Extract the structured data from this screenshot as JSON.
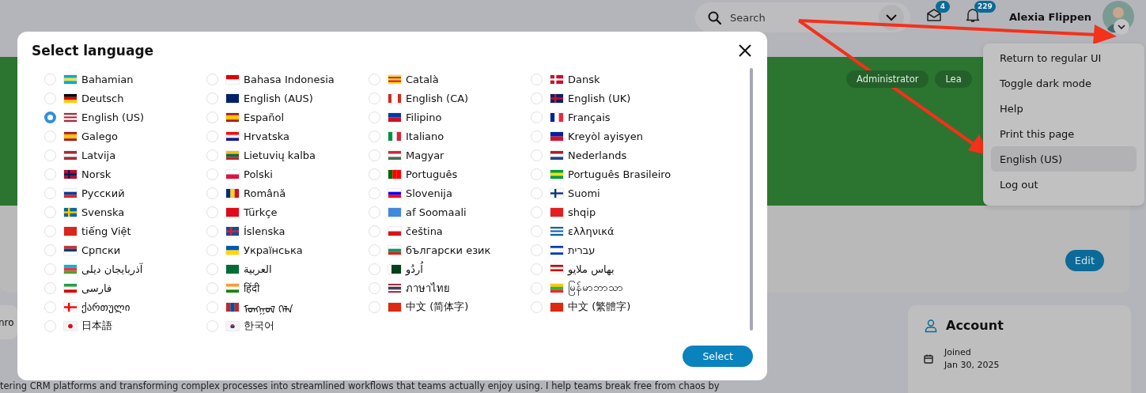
{
  "header": {
    "search": {
      "placeholder": "Search"
    },
    "messages_badge": "4",
    "notifications_badge": "229",
    "user_name": "Alexia Flippen"
  },
  "user_menu": {
    "items": [
      {
        "label": "Return to regular UI",
        "selected": false
      },
      {
        "label": "Toggle dark mode",
        "selected": false
      },
      {
        "label": "Help",
        "selected": false
      },
      {
        "label": "Print this page",
        "selected": false
      },
      {
        "label": "English (US)",
        "selected": true
      },
      {
        "label": "Log out",
        "selected": false
      }
    ]
  },
  "profile": {
    "roles": [
      "Administrator",
      "Lea"
    ],
    "edit_button": "Edit"
  },
  "side_card": {
    "text": "nro"
  },
  "account": {
    "title": "Account",
    "joined_label": "Joined",
    "joined_date": "Jan 30, 2025"
  },
  "bio_text": "tering CRM platforms and transforming complex processes into streamlined workflows that teams actually enjoy using. I help teams break free from chaos by",
  "dialog": {
    "title": "Select language",
    "select_button": "Select",
    "languages": [
      {
        "label": "Bahamian",
        "selected": false
      },
      {
        "label": "Bahasa Indonesia",
        "selected": false
      },
      {
        "label": "Català",
        "selected": false
      },
      {
        "label": "Dansk",
        "selected": false
      },
      {
        "label": "Deutsch",
        "selected": false
      },
      {
        "label": "English (AUS)",
        "selected": false
      },
      {
        "label": "English (CA)",
        "selected": false
      },
      {
        "label": "English (UK)",
        "selected": false
      },
      {
        "label": "English (US)",
        "selected": true
      },
      {
        "label": "Español",
        "selected": false
      },
      {
        "label": "Filipino",
        "selected": false
      },
      {
        "label": "Français",
        "selected": false
      },
      {
        "label": "Galego",
        "selected": false
      },
      {
        "label": "Hrvatska",
        "selected": false
      },
      {
        "label": "Italiano",
        "selected": false
      },
      {
        "label": "Kreyòl ayisyen",
        "selected": false
      },
      {
        "label": "Latvija",
        "selected": false
      },
      {
        "label": "Lietuvių kalba",
        "selected": false
      },
      {
        "label": "Magyar",
        "selected": false
      },
      {
        "label": "Nederlands",
        "selected": false
      },
      {
        "label": "Norsk",
        "selected": false
      },
      {
        "label": "Polski",
        "selected": false
      },
      {
        "label": "Português",
        "selected": false
      },
      {
        "label": "Português Brasileiro",
        "selected": false
      },
      {
        "label": "Русский",
        "selected": false
      },
      {
        "label": "Română",
        "selected": false
      },
      {
        "label": "Slovenija",
        "selected": false
      },
      {
        "label": "Suomi",
        "selected": false
      },
      {
        "label": "Svenska",
        "selected": false
      },
      {
        "label": "Türkçe",
        "selected": false
      },
      {
        "label": "af Soomaali",
        "selected": false
      },
      {
        "label": "shqip",
        "selected": false
      },
      {
        "label": "tiếng Việt",
        "selected": false
      },
      {
        "label": "Íslenska",
        "selected": false
      },
      {
        "label": "čeština",
        "selected": false
      },
      {
        "label": "ελληνικά",
        "selected": false
      },
      {
        "label": "Српски",
        "selected": false
      },
      {
        "label": "Українська",
        "selected": false
      },
      {
        "label": "български език",
        "selected": false
      },
      {
        "label": "עברית",
        "selected": false
      },
      {
        "label": "آذربایجان دیلی",
        "selected": false
      },
      {
        "label": "العربية",
        "selected": false
      },
      {
        "label": "اُردُو",
        "selected": false
      },
      {
        "label": "بهاس ملايو",
        "selected": false
      },
      {
        "label": "فارسی",
        "selected": false
      },
      {
        "label": "हिंदी",
        "selected": false
      },
      {
        "label": "ภาษาไทย",
        "selected": false
      },
      {
        "label": "မြန်မာဘာသာ",
        "selected": false
      },
      {
        "label": "ქართული",
        "selected": false
      },
      {
        "label": "ᠮᠣᠩᠭᠣᠯ ᠬᠡᠯᠡ",
        "selected": false
      },
      {
        "label": "中文 (简体字)",
        "selected": false
      },
      {
        "label": "中文 (繁體字)",
        "selected": false
      },
      {
        "label": "日本語",
        "selected": false
      },
      {
        "label": "한국어",
        "selected": false
      }
    ]
  }
}
